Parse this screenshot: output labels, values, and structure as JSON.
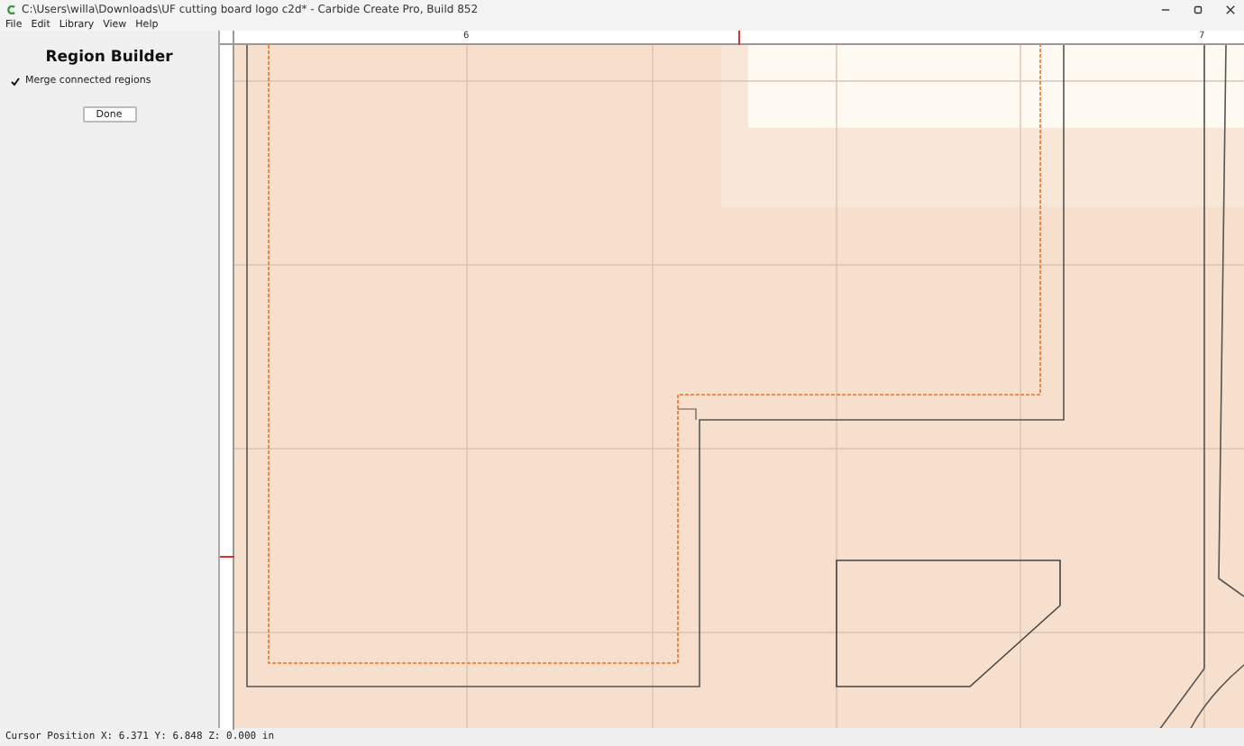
{
  "window": {
    "title": "C:\\Users\\willa\\Downloads\\UF cutting board logo c2d* - Carbide Create Pro, Build 852"
  },
  "menu": [
    "File",
    "Edit",
    "Library",
    "View",
    "Help"
  ],
  "panel": {
    "title": "Region Builder",
    "checkbox": {
      "label": "Merge connected regions",
      "checked": true
    },
    "button": "Done"
  },
  "ruler": {
    "labels": [
      "6",
      "7"
    ]
  },
  "status_bar": "Cursor Position X: 6.371 Y: 6.848 Z: 0.000 in"
}
